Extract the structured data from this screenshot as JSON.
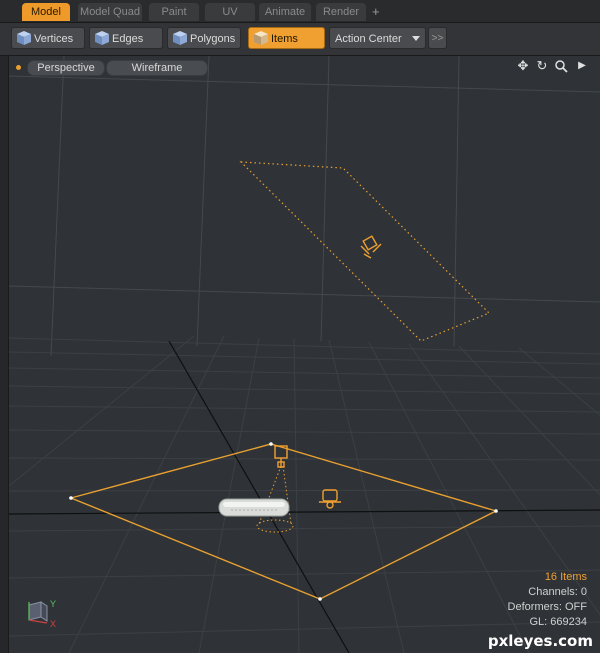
{
  "tabs": [
    {
      "label": "Model",
      "active": true
    },
    {
      "label": "Model Quad",
      "active": false
    },
    {
      "label": "Paint",
      "active": false
    },
    {
      "label": "UV",
      "active": false
    },
    {
      "label": "Animate",
      "active": false
    },
    {
      "label": "Render",
      "active": false
    }
  ],
  "tab_add_label": "+",
  "toolbar": {
    "vertices": "Vertices",
    "edges": "Edges",
    "polygons": "Polygons",
    "items": "Items",
    "action_center": "Action Center",
    "more": ">>"
  },
  "viewport": {
    "view_mode": "Perspective",
    "shading": "Wireframe",
    "nav_icons": [
      "move-icon",
      "rotate-icon",
      "zoom-icon",
      "play-icon"
    ]
  },
  "stats": {
    "items": "16 Items",
    "channels": "Channels: 0",
    "deformers": "Deformers: OFF",
    "gl": "GL: 669234"
  },
  "axis": {
    "y": "Y",
    "x": "X"
  },
  "watermark": "pxleyes.com",
  "colors": {
    "accent": "#f0a030",
    "viewport_bg": "#2f3337",
    "grid": "#3c4045"
  }
}
